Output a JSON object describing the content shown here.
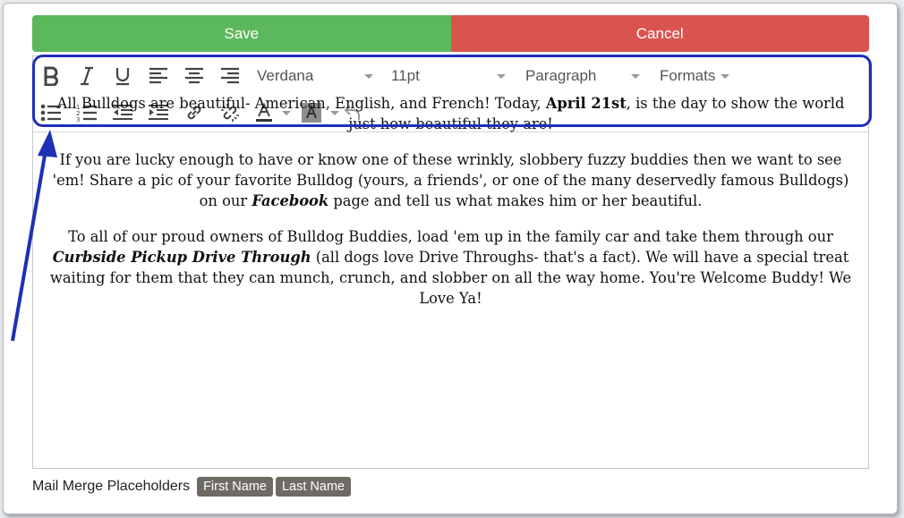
{
  "buttons": {
    "save_label": "Save",
    "cancel_label": "Cancel"
  },
  "toolbar": {
    "font_family": "Verdana",
    "font_size": "11pt",
    "block_format": "Paragraph",
    "formats_label": "Formats",
    "icons": [
      "bold-icon",
      "italic-icon",
      "underline-icon",
      "align-left-icon",
      "align-center-icon",
      "align-right-icon",
      "bullet-list-icon",
      "numbered-list-icon",
      "outdent-icon",
      "indent-icon",
      "link-icon",
      "unlink-icon",
      "text-color-icon",
      "background-color-icon",
      "undo-icon"
    ]
  },
  "content": {
    "p1": {
      "a": "All Bulldogs are beautiful- American, English, and French! Today, ",
      "b": "April 21st",
      "c": ",  is the day to show the world just how beautiful they are!"
    },
    "p2": {
      "a": "If you are lucky enough to have or know one of these wrinkly, slobbery fuzzy buddies then we want to see 'em! Share a pic of your favorite Bulldog (yours, a friends', or one of the many deservedly famous Bulldogs) on our ",
      "b": "Facebook",
      "c": " page and tell us what makes him or her beautiful."
    },
    "p3": {
      "a": "To all of our proud owners of Bulldog Buddies, load 'em up in the family car and take them through our ",
      "b": "Curbside Pickup Drive Through",
      "c": " (all dogs love Drive Throughs- that's a fact). We will have a special treat waiting for them that they can munch, crunch, and slobber on all the way home. You're Welcome Buddy! We Love Ya!"
    }
  },
  "footer": {
    "label": "Mail Merge Placeholders",
    "tags": [
      "First Name",
      "Last Name"
    ]
  },
  "colors": {
    "save": "#5cb85c",
    "cancel": "#d9534f",
    "annotation": "#1f2fb8",
    "tag": "#6e6a64"
  }
}
